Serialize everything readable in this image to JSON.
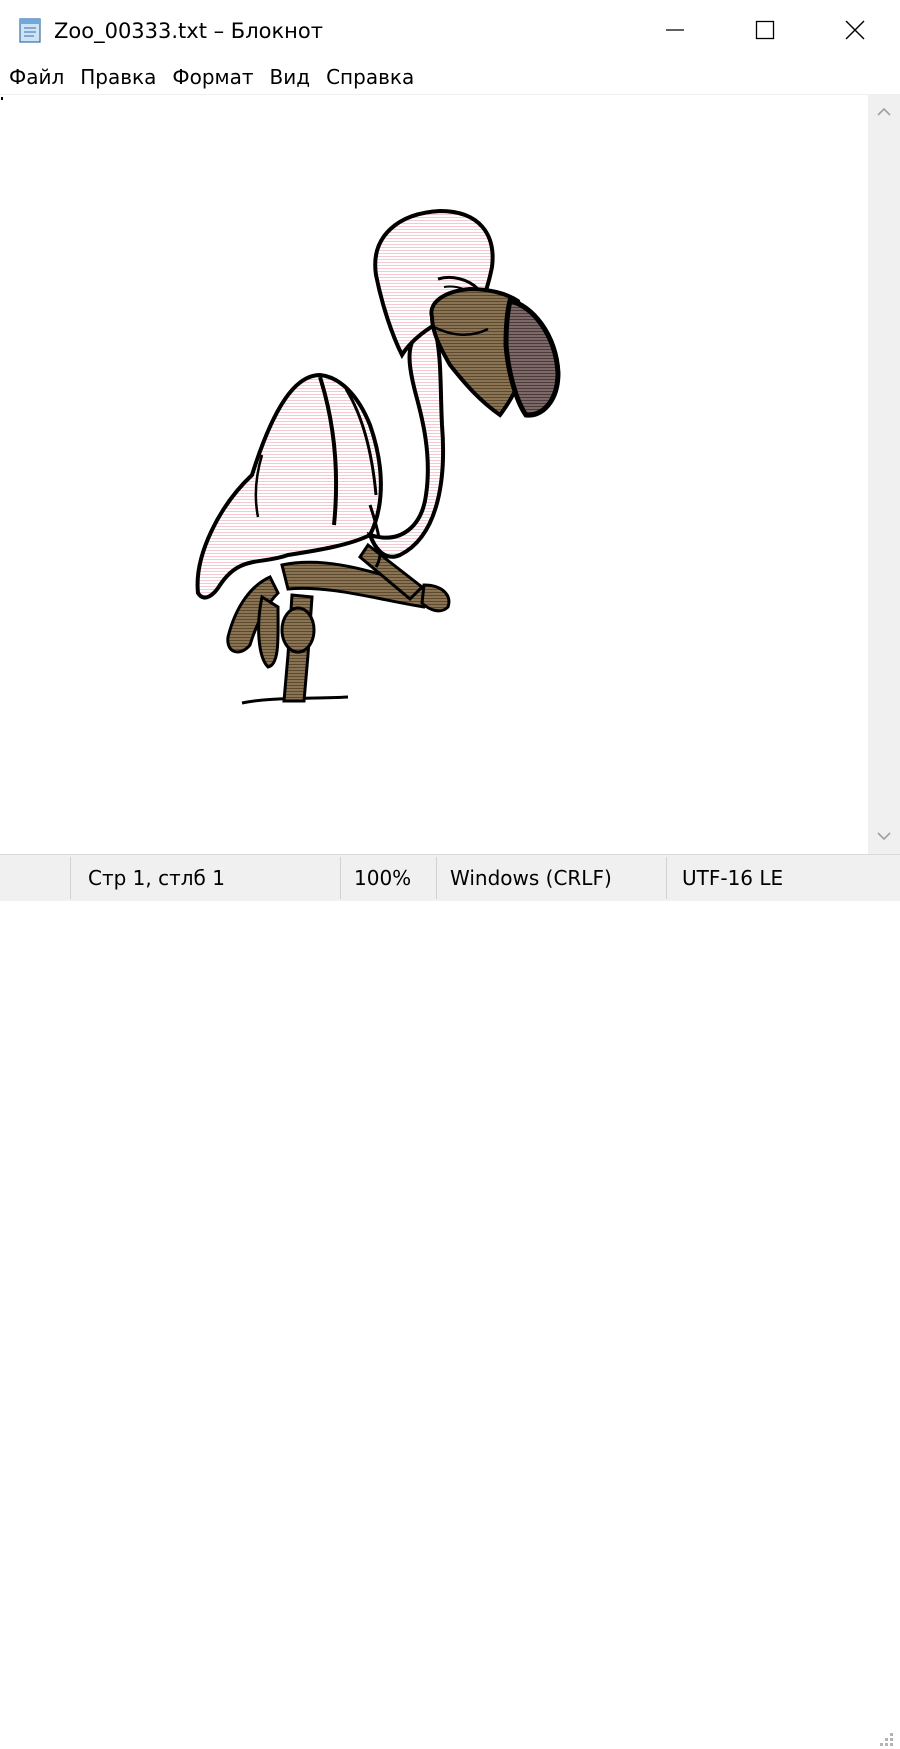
{
  "window": {
    "title": "Zoo_00333.txt – Блокнот",
    "app_icon": "notepad-icon",
    "controls": [
      "minimize-icon",
      "maximize-icon",
      "close-icon"
    ]
  },
  "menu": {
    "items": [
      {
        "label": "Файл"
      },
      {
        "label": "Правка"
      },
      {
        "label": "Формат"
      },
      {
        "label": "Вид"
      },
      {
        "label": "Справка"
      }
    ]
  },
  "editor": {
    "content_icon": "flamingo-ascii-art"
  },
  "status": {
    "position": "Стр 1, стлб 1",
    "zoom": "100%",
    "line_ending": "Windows (CRLF)",
    "encoding": "UTF-16 LE"
  },
  "colors": {
    "accent_pink": "#fbe6ea",
    "beak_brown": "#7a6548",
    "beak_tip": "#6e5a5a",
    "status_bg": "#f0f0f0"
  }
}
